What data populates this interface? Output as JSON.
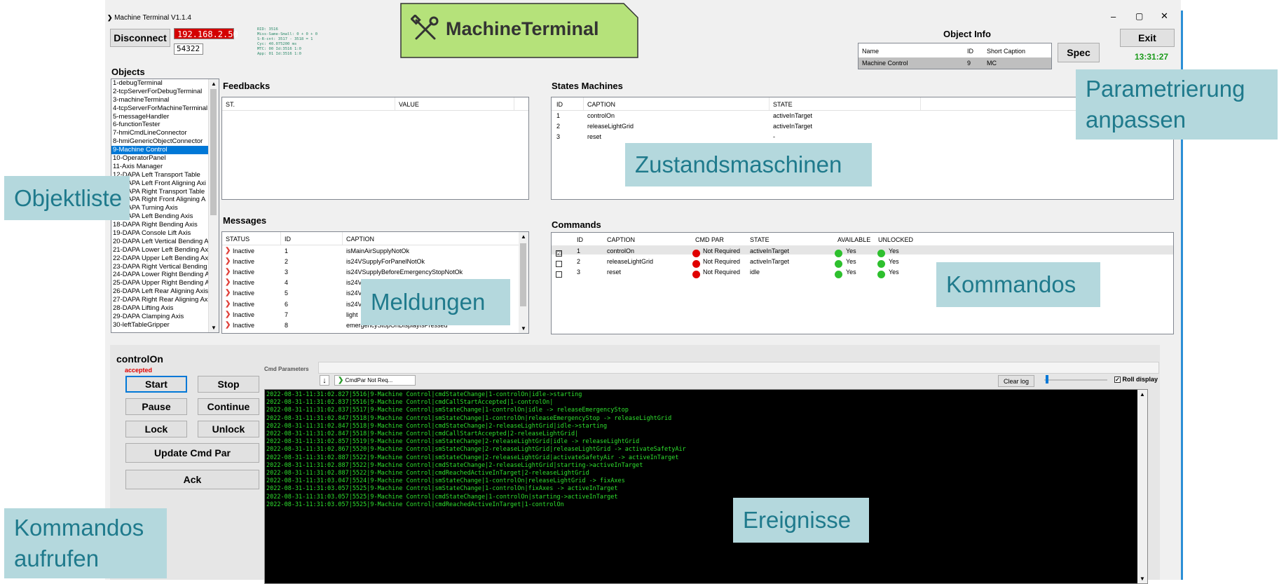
{
  "window": {
    "title": "Machine Terminal V1.1.4",
    "controls": [
      "–",
      "▢",
      "✕"
    ]
  },
  "connection": {
    "disconnect_label": "Disconnect",
    "ip": "192.168.2.50",
    "port": "54322",
    "status_lines": [
      "RID: 3516",
      "Miss-Same-Small: 0 + 0 + 0",
      "S-R-cnt: 3517 - 3518 = 1",
      "Cyc: 40.075200 ms",
      "MTC: 00 Id:3516 1:0",
      "App: 01 Id:3516 1:0"
    ]
  },
  "logo": {
    "text": "MachineTerminal",
    "icon": "tools-icon"
  },
  "object_info": {
    "title": "Object Info",
    "columns": [
      "Name",
      "ID",
      "Short Caption"
    ],
    "row": [
      "Machine Control",
      "9",
      "MC"
    ],
    "spec_label": "Spec",
    "exit_label": "Exit",
    "time": "13:31:27"
  },
  "objects": {
    "title": "Objects",
    "items": [
      "1-debugTerminal",
      "2-tcpServerForDebugTerminal",
      "3-machineTerminal",
      "4-tcpServerForMachineTerminal",
      "5-messageHandler",
      "6-functionTester",
      "7-hmiCmdLineConnector",
      "8-hmiGenericObjectConnector",
      "9-Machine Control",
      "10-OperatorPanel",
      "11-Axis Manager",
      "12-DAPA Left Transport Table",
      "13-DAPA Left Front Aligning Axi",
      "14-DAPA Right Transport Table",
      "15-DAPA Right Front Aligning A",
      "16-DAPA Turning Axis",
      "17-DAPA Left Bending Axis",
      "18-DAPA Right Bending Axis",
      "19-DAPA Console Lift Axis",
      "20-DAPA Left Vertical Bending A",
      "21-DAPA Lower Left Bending Ax",
      "22-DAPA Upper Left Bending Ax",
      "23-DAPA Right Vertical Bending",
      "24-DAPA Lower Right Bending A",
      "25-DAPA Upper Right Bending A",
      "26-DAPA Left Rear Aligning Axis",
      "27-DAPA Right Rear Aligning Ax",
      "28-DAPA Lifting Axis",
      "29-DAPA Clamping Axis",
      "30-leftTableGripper"
    ],
    "selected_index": 8
  },
  "feedbacks": {
    "title": "Feedbacks",
    "columns": [
      "ST.",
      "VALUE"
    ]
  },
  "states": {
    "title": "States Machines",
    "columns": [
      "ID",
      "CAPTION",
      "STATE"
    ],
    "rows": [
      [
        "1",
        "controlOn",
        "activeInTarget"
      ],
      [
        "2",
        "releaseLightGrid",
        "activeInTarget"
      ],
      [
        "3",
        "reset",
        "-"
      ]
    ]
  },
  "messages": {
    "title": "Messages",
    "columns": [
      "STATUS",
      "ID",
      "CAPTION"
    ],
    "rows": [
      [
        "Inactive",
        "1",
        "isMainAirSupplyNotOk"
      ],
      [
        "Inactive",
        "2",
        "is24VSupplyForPanelNotOk"
      ],
      [
        "Inactive",
        "3",
        "is24VSupplyBeforeEmergencyStopNotOk"
      ],
      [
        "Inactive",
        "4",
        "is24V"
      ],
      [
        "Inactive",
        "5",
        "is24V"
      ],
      [
        "Inactive",
        "6",
        "is24V"
      ],
      [
        "Inactive",
        "7",
        "light"
      ],
      [
        "Inactive",
        "8",
        "emergencyStopOnDisplayIsPressed"
      ]
    ]
  },
  "commands": {
    "title": "Commands",
    "columns": [
      "ID",
      "CAPTION",
      "CMD PAR",
      "STATE",
      "AVAILABLE",
      "UNLOCKED"
    ],
    "rows": [
      {
        "checked": "☑",
        "id": "1",
        "caption": "controlOn",
        "par": "Not Required",
        "state": "activeInTarget",
        "avail": "Yes",
        "unlocked": "Yes"
      },
      {
        "checked": "",
        "id": "2",
        "caption": "releaseLightGrid",
        "par": "Not Required",
        "state": "activeInTarget",
        "avail": "Yes",
        "unlocked": "Yes"
      },
      {
        "checked": "",
        "id": "3",
        "caption": "reset",
        "par": "Not Required",
        "state": "idle",
        "avail": "Yes",
        "unlocked": "Yes"
      }
    ]
  },
  "control": {
    "cmd_name": "controlOn",
    "status": "accepted",
    "buttons": {
      "start": "Start",
      "stop": "Stop",
      "pause": "Pause",
      "continue": "Continue",
      "lock": "Lock",
      "unlock": "Unlock",
      "update": "Update Cmd Par",
      "ack": "Ack"
    },
    "cmd_params_label": "Cmd Parameters",
    "cmd_par_value": "CmdPar Not Req...",
    "clear_log": "Clear log",
    "roll_display": "Roll display"
  },
  "log": [
    "2022-08-31-11:31:02.827|5516|9-Machine Control|cmdStateChange|1-controlOn|idle->starting",
    "2022-08-31-11:31:02.837|5516|9-Machine Control|cmdCallStartAccepted|1-controlOn|",
    "2022-08-31-11:31:02.837|5517|9-Machine Control|smStateChange|1-controlOn|idle -> releaseEmergencyStop",
    "2022-08-31-11:31:02.847|5518|9-Machine Control|smStateChange|1-controlOn|releaseEmergencyStop -> releaseLightGrid",
    "2022-08-31-11:31:02.847|5518|9-Machine Control|cmdStateChange|2-releaseLightGrid|idle->starting",
    "2022-08-31-11:31:02.847|5518|9-Machine Control|cmdCallStartAccepted|2-releaseLightGrid|",
    "2022-08-31-11:31:02.857|5519|9-Machine Control|smStateChange|2-releaseLightGrid|idle -> releaseLightGrid",
    "2022-08-31-11:31:02.867|5520|9-Machine Control|smStateChange|2-releaseLightGrid|releaseLightGrid -> activateSafetyAir",
    "2022-08-31-11:31:02.887|5522|9-Machine Control|smStateChange|2-releaseLightGrid|activateSafetyAir -> activeInTarget",
    "2022-08-31-11:31:02.887|5522|9-Machine Control|cmdStateChange|2-releaseLightGrid|starting->activeInTarget",
    "2022-08-31-11:31:02.887|5522|9-Machine Control|cmdReachedActiveInTarget|2-releaseLightGrid",
    "2022-08-31-11:31:03.047|5524|9-Machine Control|smStateChange|1-controlOn|releaseLightGrid -> fixAxes",
    "2022-08-31-11:31:03.057|5525|9-Machine Control|smStateChange|1-controlOn|fixAxes -> activeInTarget",
    "2022-08-31-11:31:03.057|5525|9-Machine Control|cmdStateChange|1-controlOn|starting->activeInTarget",
    "2022-08-31-11:31:03.057|5525|9-Machine Control|cmdReachedActiveInTarget|1-controlOn"
  ],
  "annotations": {
    "objektliste": "Objektliste",
    "meldungen": "Meldungen",
    "zustandsmaschinen": "Zustandsmaschinen",
    "kommandos": "Kommandos",
    "parametrierung": [
      "Parametrierung",
      "anpassen"
    ],
    "kommandos_aufrufen": [
      "Kommandos",
      "aufrufen"
    ],
    "ereignisse": "Ereignisse"
  },
  "colors": {
    "accent": "#0078d7",
    "logo_bg": "#b5e27a",
    "overlay_bg": "#b4d8dd",
    "overlay_text": "#1f7a8c",
    "log_text": "#2ee02e",
    "red": "#e00000",
    "green": "#2ec02e"
  }
}
